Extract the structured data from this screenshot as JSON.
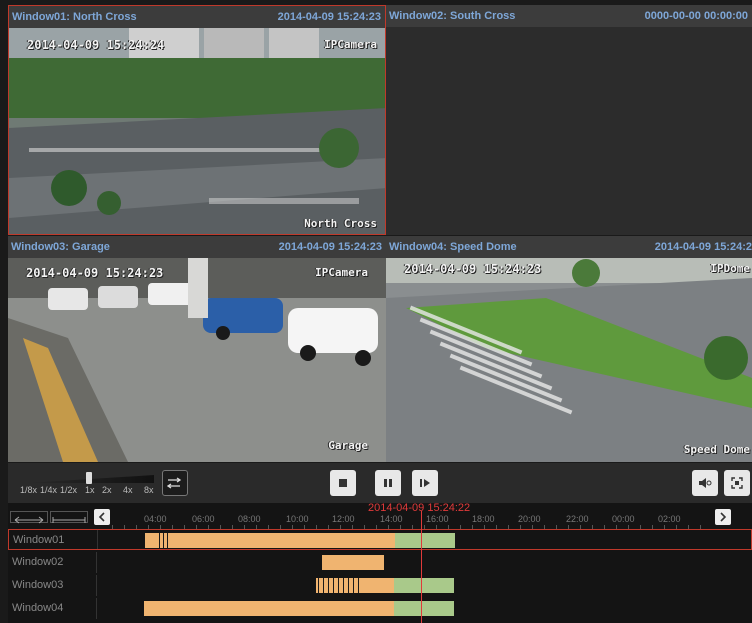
{
  "windows": [
    {
      "title": "Window01: North Cross",
      "timestamp": "2014-04-09 15:24:23",
      "osd_time": "2014-04-09 15:24:24",
      "osd_label": "IPCamera",
      "osd_name": "North Cross"
    },
    {
      "title": "Window02: South Cross",
      "timestamp": "0000-00-00 00:00:00"
    },
    {
      "title": "Window03: Garage",
      "timestamp": "2014-04-09 15:24:23",
      "osd_time": "2014-04-09 15:24:23",
      "osd_label": "IPCamera",
      "osd_name": "Garage"
    },
    {
      "title": "Window04: Speed Dome",
      "timestamp": "2014-04-09 15:24:2",
      "osd_time": "2014-04-09 15:24:23",
      "osd_label": "IPDome",
      "osd_name": "Speed Dome"
    }
  ],
  "controls": {
    "speed_labels": [
      "1/8x",
      "1/4x",
      "1/2x",
      "1x",
      "2x",
      "4x",
      "8x"
    ],
    "speed_selected": "1x",
    "buttons": [
      "stop",
      "pause",
      "step-forward"
    ],
    "right_buttons": [
      "volume-mute",
      "fullscreen"
    ]
  },
  "timeline": {
    "current_time": "2014-04-09 15:24:22",
    "tick_labels": [
      "04:00",
      "06:00",
      "08:00",
      "10:00",
      "12:00",
      "14:00",
      "16:00",
      "18:00",
      "20:00",
      "22:00",
      "00:00",
      "02:00"
    ],
    "rows": [
      {
        "label": "Window01",
        "selected": true
      },
      {
        "label": "Window02",
        "selected": false
      },
      {
        "label": "Window03",
        "selected": false
      },
      {
        "label": "Window04",
        "selected": false
      }
    ]
  },
  "colors": {
    "accent_red": "#e03a3a",
    "record_orange": "#f0b470",
    "record_green": "#a9c98a",
    "title_blue": "#7ea7d8"
  }
}
